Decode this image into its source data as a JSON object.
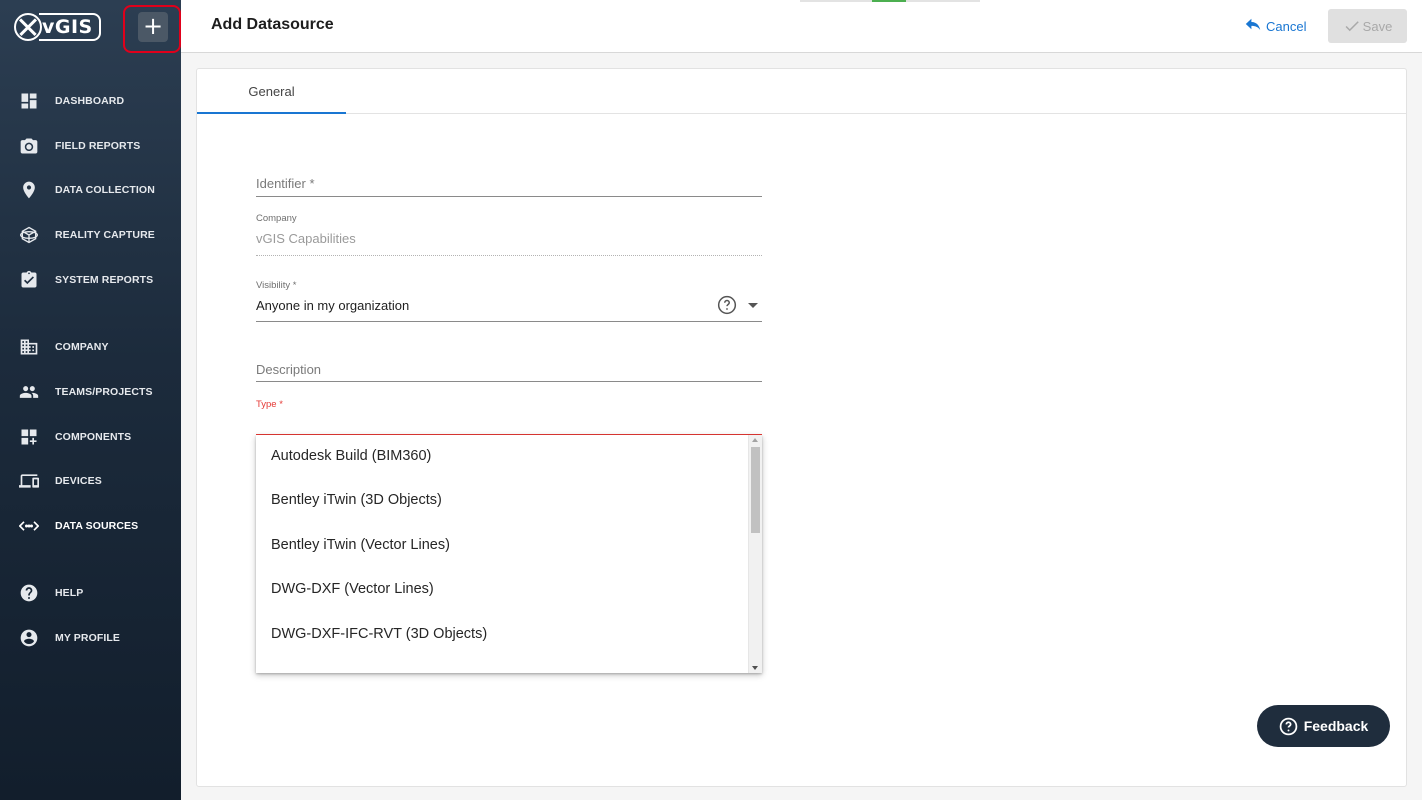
{
  "brand": {
    "logo_text": "vGIS"
  },
  "sidebar": {
    "add_button_label": "+",
    "items": [
      {
        "label": "DASHBOARD",
        "icon": "dashboard-icon"
      },
      {
        "label": "FIELD REPORTS",
        "icon": "camera-icon"
      },
      {
        "label": "DATA COLLECTION",
        "icon": "location-pin-icon"
      },
      {
        "label": "REALITY CAPTURE",
        "icon": "cube-icon"
      },
      {
        "label": "SYSTEM REPORTS",
        "icon": "clipboard-check-icon"
      },
      {
        "label": "COMPANY",
        "icon": "building-icon"
      },
      {
        "label": "TEAMS/PROJECTS",
        "icon": "people-icon"
      },
      {
        "label": "COMPONENTS",
        "icon": "widgets-add-icon"
      },
      {
        "label": "DEVICES",
        "icon": "devices-icon"
      },
      {
        "label": "DATA SOURCES",
        "icon": "code-arrows-icon",
        "active": true
      },
      {
        "label": "HELP",
        "icon": "help-circle-icon"
      },
      {
        "label": "MY PROFILE",
        "icon": "account-circle-icon"
      }
    ]
  },
  "header": {
    "title": "Add Datasource",
    "cancel_label": "Cancel",
    "save_label": "Save"
  },
  "tabs": [
    {
      "label": "General",
      "active": true
    }
  ],
  "form": {
    "identifier": {
      "placeholder": "Identifier *",
      "value": ""
    },
    "company": {
      "label": "Company",
      "value": "vGIS Capabilities"
    },
    "visibility": {
      "label": "Visibility *",
      "value": "Anyone in my organization"
    },
    "description": {
      "placeholder": "Description",
      "value": ""
    },
    "type": {
      "label": "Type *",
      "value": ""
    }
  },
  "type_options": [
    "Autodesk Build (BIM360)",
    "Bentley iTwin (3D Objects)",
    "Bentley iTwin (Vector Lines)",
    "DWG-DXF (Vector Lines)",
    "DWG-DXF-IFC-RVT (3D Objects)"
  ],
  "feedback": {
    "label": "Feedback"
  },
  "colors": {
    "accent": "#1976d2",
    "error": "#e53935",
    "sidebar_bg": "#1c2b3c",
    "highlight": "#e0001b"
  }
}
